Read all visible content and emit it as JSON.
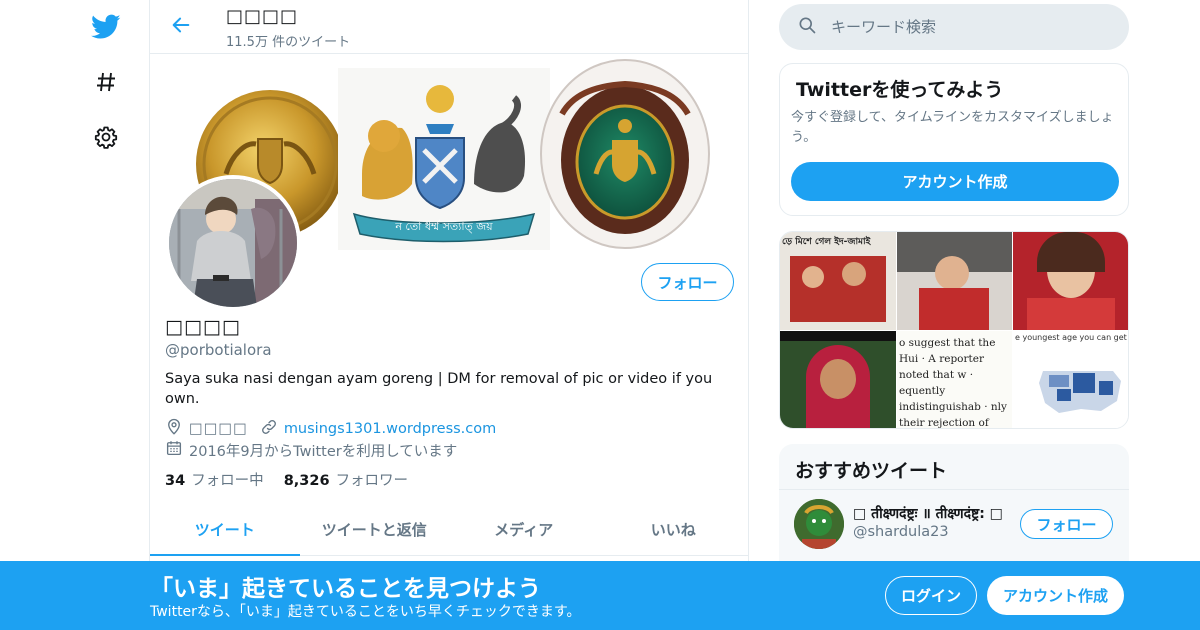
{
  "colors": {
    "accent": "#1da1f2",
    "text": "#14171a",
    "muted": "#657786",
    "border": "#e6ecf0"
  },
  "nav": {
    "items": [
      {
        "icon": "twitter-bird-icon"
      },
      {
        "icon": "hashtag-icon"
      },
      {
        "icon": "gear-icon"
      }
    ]
  },
  "header": {
    "name": "□□□□",
    "tweet_count": "11.5万 件のツイート"
  },
  "profile": {
    "name": "□□□□",
    "handle": "@porbotialora",
    "bio": "Saya suka nasi dengan ayam goreng | DM for removal of pic or video if you own.",
    "location": "□□□□",
    "website": "musings1301.wordpress.com",
    "joined": "2016年9月からTwitterを利用しています",
    "following_count": "34",
    "following_label": "フォロー中",
    "followers_count": "8,326",
    "followers_label": "フォロワー",
    "follow_label": "フォロー",
    "banner_motto": "ন তো ধর্ম্ম সত্যাত্ জয়"
  },
  "tabs": [
    {
      "label": "ツイート",
      "active": true
    },
    {
      "label": "ツイートと返信",
      "active": false
    },
    {
      "label": "メディア",
      "active": false
    },
    {
      "label": "いいね",
      "active": false
    }
  ],
  "search": {
    "placeholder": "キーワード検索"
  },
  "signup_card": {
    "title": "Twitterを使ってみよう",
    "description": "今すぐ登録して、タイムラインをカスタマイズしましょう。",
    "button": "アカウント作成"
  },
  "media_grid": {
    "texts": {
      "cell1_headline": "ড়ে মিশে গেল ইদ-জামাই",
      "cell5_quote": "o suggest that the Hui · A reporter noted that w · equently indistinguishab · nly their rejection of pork · inscriptions in mosques · m from Han neighbors\"",
      "cell6_caption": "e youngest age you can get married by stat"
    }
  },
  "recommended": {
    "title": "おすすめツイート",
    "items": [
      {
        "name": "□ तीक्ष्णदंष्ट्रः ॥ तीक्ष्णदंष्ट्र: □",
        "handle": "@shardula23",
        "follow_label": "フォロー"
      }
    ]
  },
  "bottom_bar": {
    "title": "「いま」起きていることを見つけよう",
    "subtitle": "Twitterなら、「いま」起きていることをいち早くチェックできます。",
    "login": "ログイン",
    "signup": "アカウント作成"
  }
}
